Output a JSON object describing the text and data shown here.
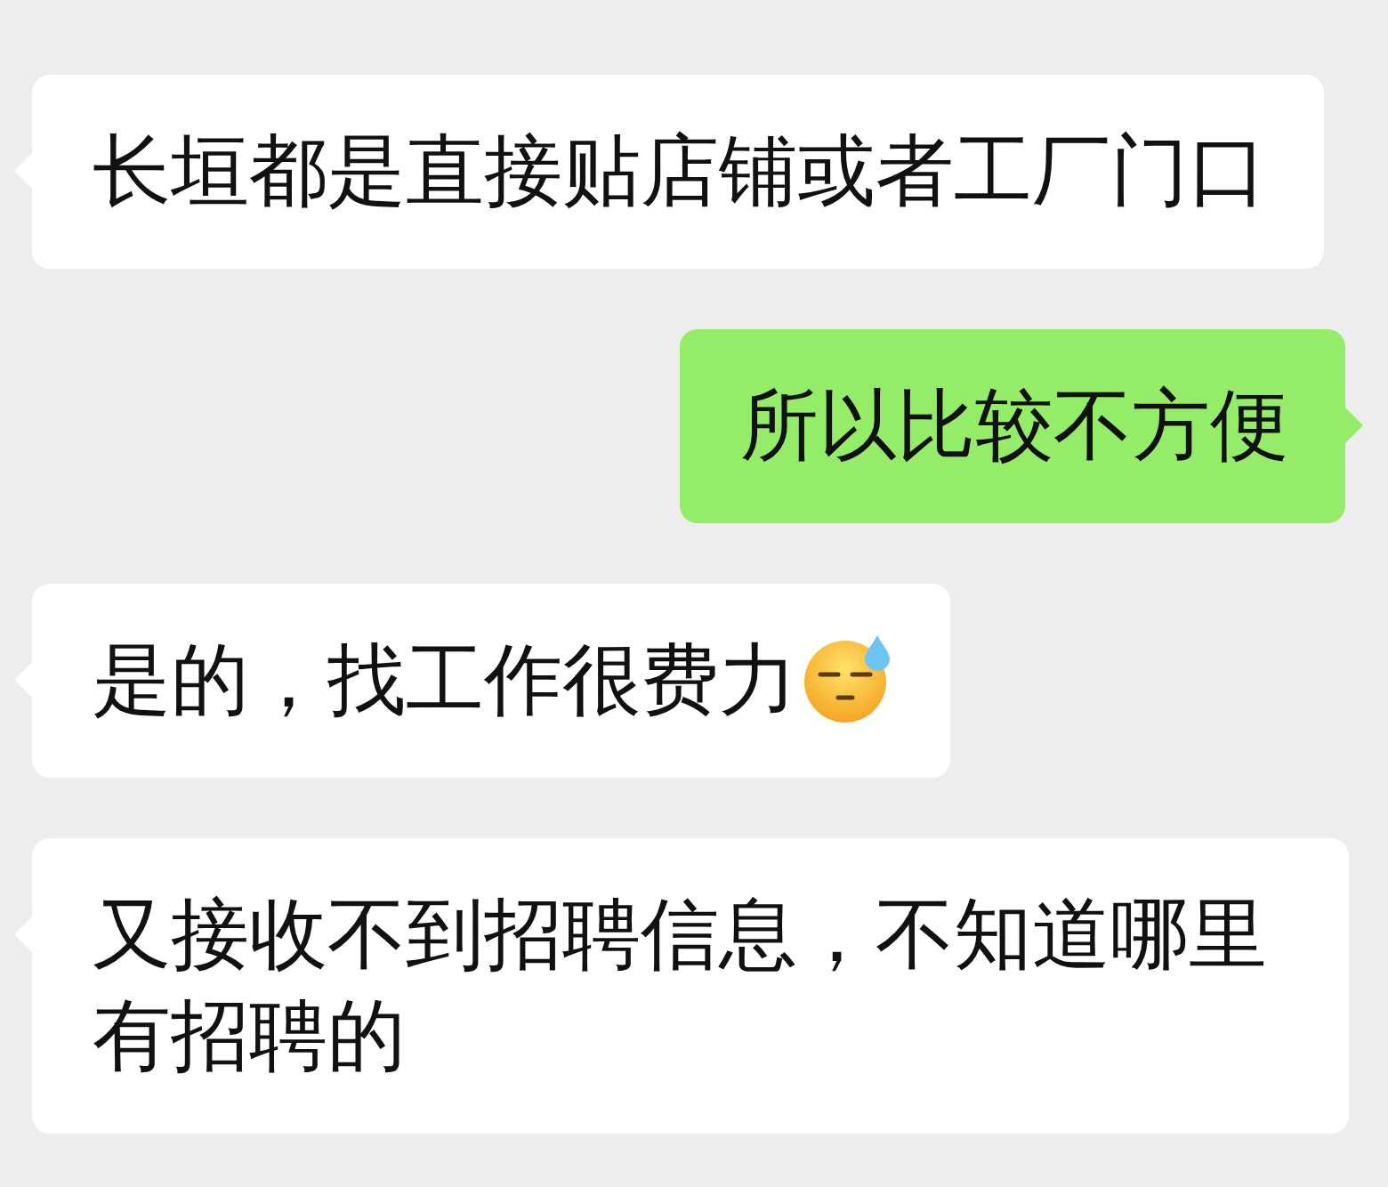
{
  "messages": [
    {
      "kind": "received",
      "text": "长垣都是直接贴店铺或者工厂门口",
      "emoji": false
    },
    {
      "kind": "sent",
      "text": "所以比较不方便",
      "emoji": false
    },
    {
      "kind": "received",
      "text": "是的，找工作很费力",
      "emoji": true
    },
    {
      "kind": "received",
      "text": "又接收不到招聘信息，不知道哪里有招聘的",
      "emoji": false
    }
  ]
}
